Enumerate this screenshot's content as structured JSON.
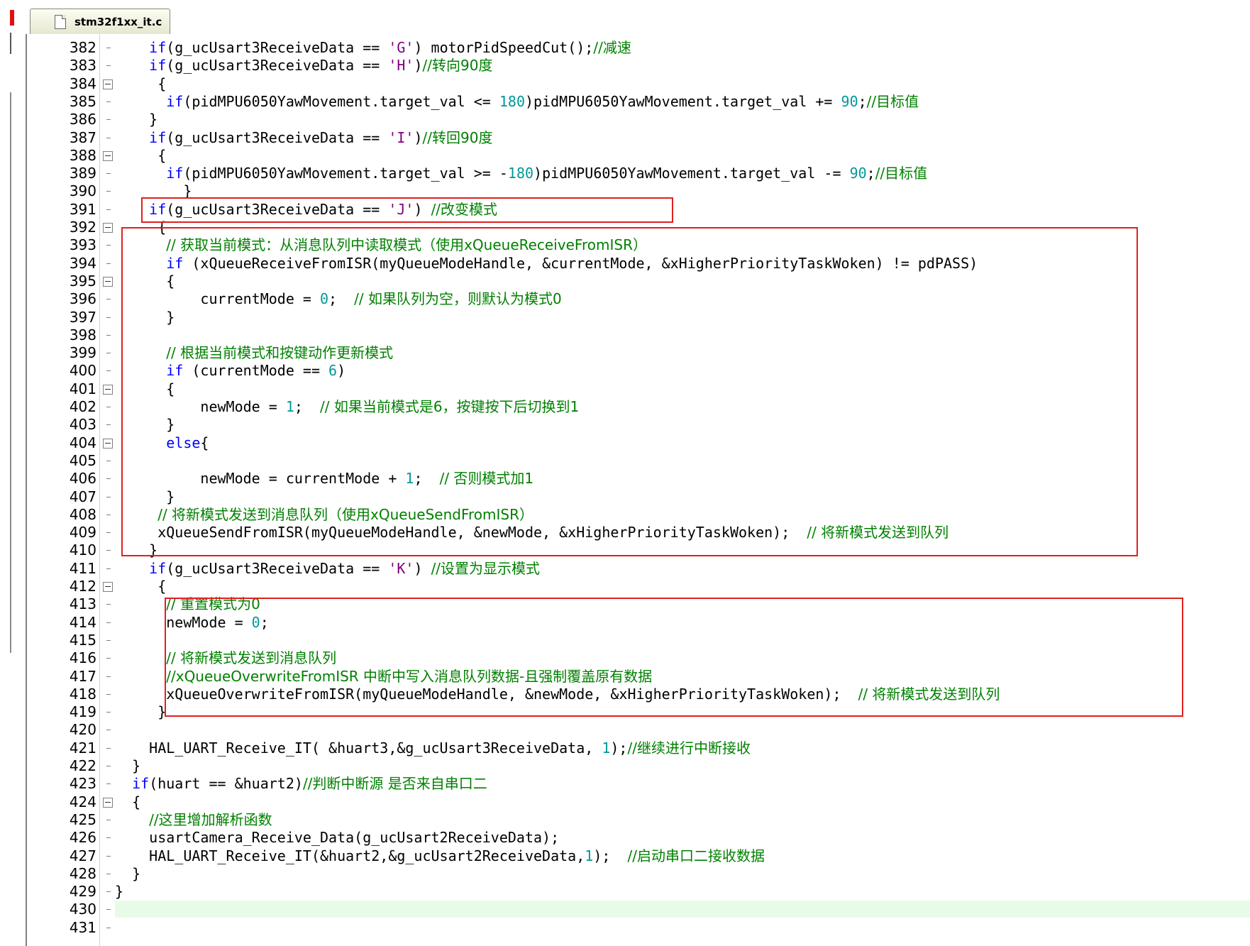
{
  "tab": {
    "filename": "stm32f1xx_it.c"
  },
  "lines": [
    {
      "n": "382",
      "code": [
        {
          "t": "    "
        },
        {
          "t": "if",
          "c": "kw"
        },
        {
          "t": "(g_ucUsart3ReceiveData == "
        },
        {
          "t": "'G'",
          "c": "str"
        },
        {
          "t": ") motorPidSpeedCut();"
        },
        {
          "t": "//减速",
          "c": "cmt"
        }
      ]
    },
    {
      "n": "383",
      "code": [
        {
          "t": "    "
        },
        {
          "t": "if",
          "c": "kw"
        },
        {
          "t": "(g_ucUsart3ReceiveData == "
        },
        {
          "t": "'H'",
          "c": "str"
        },
        {
          "t": ")"
        },
        {
          "t": "//转向90度",
          "c": "cmt"
        }
      ]
    },
    {
      "n": "384",
      "fold": true,
      "code": [
        {
          "t": "     {"
        }
      ]
    },
    {
      "n": "385",
      "code": [
        {
          "t": "      "
        },
        {
          "t": "if",
          "c": "kw"
        },
        {
          "t": "(pidMPU6050YawMovement.target_val <= "
        },
        {
          "t": "180",
          "c": "num"
        },
        {
          "t": ")pidMPU6050YawMovement.target_val += "
        },
        {
          "t": "90",
          "c": "num"
        },
        {
          "t": ";"
        },
        {
          "t": "//目标值",
          "c": "cmt"
        }
      ]
    },
    {
      "n": "386",
      "code": [
        {
          "t": "    }"
        }
      ]
    },
    {
      "n": "387",
      "code": [
        {
          "t": "    "
        },
        {
          "t": "if",
          "c": "kw"
        },
        {
          "t": "(g_ucUsart3ReceiveData == "
        },
        {
          "t": "'I'",
          "c": "str"
        },
        {
          "t": ")"
        },
        {
          "t": "//转回90度",
          "c": "cmt"
        }
      ]
    },
    {
      "n": "388",
      "fold": true,
      "code": [
        {
          "t": "     {"
        }
      ]
    },
    {
      "n": "389",
      "code": [
        {
          "t": "      "
        },
        {
          "t": "if",
          "c": "kw"
        },
        {
          "t": "(pidMPU6050YawMovement.target_val >= -"
        },
        {
          "t": "180",
          "c": "num"
        },
        {
          "t": ")pidMPU6050YawMovement.target_val -= "
        },
        {
          "t": "90",
          "c": "num"
        },
        {
          "t": ";"
        },
        {
          "t": "//目标值",
          "c": "cmt"
        }
      ]
    },
    {
      "n": "390",
      "code": [
        {
          "t": "        }"
        }
      ]
    },
    {
      "n": "391",
      "code": [
        {
          "t": "    "
        },
        {
          "t": "if",
          "c": "kw"
        },
        {
          "t": "(g_ucUsart3ReceiveData == "
        },
        {
          "t": "'J'",
          "c": "str"
        },
        {
          "t": ") "
        },
        {
          "t": "//改变模式",
          "c": "cmt"
        }
      ]
    },
    {
      "n": "392",
      "fold": true,
      "code": [
        {
          "t": "     {"
        }
      ]
    },
    {
      "n": "393",
      "code": [
        {
          "t": "      "
        },
        {
          "t": "// 获取当前模式：从消息队列中读取模式（使用xQueueReceiveFromISR）",
          "c": "cmt"
        }
      ]
    },
    {
      "n": "394",
      "code": [
        {
          "t": "      "
        },
        {
          "t": "if",
          "c": "kw"
        },
        {
          "t": " (xQueueReceiveFromISR(myQueueModeHandle, &currentMode, &xHigherPriorityTaskWoken) != pdPASS)"
        }
      ]
    },
    {
      "n": "395",
      "fold": true,
      "code": [
        {
          "t": "      {"
        }
      ]
    },
    {
      "n": "396",
      "code": [
        {
          "t": "          currentMode = "
        },
        {
          "t": "0",
          "c": "num"
        },
        {
          "t": ";  "
        },
        {
          "t": "// 如果队列为空，则默认为模式0",
          "c": "cmt"
        }
      ]
    },
    {
      "n": "397",
      "code": [
        {
          "t": "      }"
        }
      ]
    },
    {
      "n": "398",
      "code": [
        {
          "t": ""
        }
      ]
    },
    {
      "n": "399",
      "code": [
        {
          "t": "      "
        },
        {
          "t": "// 根据当前模式和按键动作更新模式",
          "c": "cmt"
        }
      ]
    },
    {
      "n": "400",
      "code": [
        {
          "t": "      "
        },
        {
          "t": "if",
          "c": "kw"
        },
        {
          "t": " (currentMode == "
        },
        {
          "t": "6",
          "c": "num"
        },
        {
          "t": ")"
        }
      ]
    },
    {
      "n": "401",
      "fold": true,
      "code": [
        {
          "t": "      {"
        }
      ]
    },
    {
      "n": "402",
      "code": [
        {
          "t": "          newMode = "
        },
        {
          "t": "1",
          "c": "num"
        },
        {
          "t": ";  "
        },
        {
          "t": "// 如果当前模式是6，按键按下后切换到1",
          "c": "cmt"
        }
      ]
    },
    {
      "n": "403",
      "code": [
        {
          "t": "      }"
        }
      ]
    },
    {
      "n": "404",
      "fold": true,
      "code": [
        {
          "t": "      "
        },
        {
          "t": "else",
          "c": "kw"
        },
        {
          "t": "{"
        }
      ]
    },
    {
      "n": "405",
      "code": [
        {
          "t": ""
        }
      ]
    },
    {
      "n": "406",
      "code": [
        {
          "t": "          newMode = currentMode + "
        },
        {
          "t": "1",
          "c": "num"
        },
        {
          "t": ";  "
        },
        {
          "t": "// 否则模式加1",
          "c": "cmt"
        }
      ]
    },
    {
      "n": "407",
      "code": [
        {
          "t": "      }"
        }
      ]
    },
    {
      "n": "408",
      "code": [
        {
          "t": "     "
        },
        {
          "t": "// 将新模式发送到消息队列（使用xQueueSendFromISR）",
          "c": "cmt"
        }
      ]
    },
    {
      "n": "409",
      "code": [
        {
          "t": "     xQueueSendFromISR(myQueueModeHandle, &newMode, &xHigherPriorityTaskWoken);  "
        },
        {
          "t": "// 将新模式发送到队列",
          "c": "cmt"
        }
      ]
    },
    {
      "n": "410",
      "code": [
        {
          "t": "    }"
        }
      ]
    },
    {
      "n": "411",
      "code": [
        {
          "t": "    "
        },
        {
          "t": "if",
          "c": "kw"
        },
        {
          "t": "(g_ucUsart3ReceiveData == "
        },
        {
          "t": "'K'",
          "c": "str"
        },
        {
          "t": ") "
        },
        {
          "t": "//设置为显示模式",
          "c": "cmt"
        }
      ]
    },
    {
      "n": "412",
      "fold": true,
      "code": [
        {
          "t": "     {"
        }
      ]
    },
    {
      "n": "413",
      "code": [
        {
          "t": "      "
        },
        {
          "t": "// 重置模式为0",
          "c": "cmt"
        }
      ]
    },
    {
      "n": "414",
      "code": [
        {
          "t": "      newMode = "
        },
        {
          "t": "0",
          "c": "num"
        },
        {
          "t": ";"
        }
      ]
    },
    {
      "n": "415",
      "code": [
        {
          "t": ""
        }
      ]
    },
    {
      "n": "416",
      "code": [
        {
          "t": "      "
        },
        {
          "t": "// 将新模式发送到消息队列",
          "c": "cmt"
        }
      ]
    },
    {
      "n": "417",
      "code": [
        {
          "t": "      "
        },
        {
          "t": "//xQueueOverwriteFromISR 中断中写入消息队列数据-且强制覆盖原有数据",
          "c": "cmt"
        }
      ]
    },
    {
      "n": "418",
      "code": [
        {
          "t": "      xQueueOverwriteFromISR(myQueueModeHandle, &newMode, &xHigherPriorityTaskWoken);  "
        },
        {
          "t": "// 将新模式发送到队列",
          "c": "cmt"
        }
      ]
    },
    {
      "n": "419",
      "code": [
        {
          "t": "     }"
        }
      ]
    },
    {
      "n": "420",
      "code": [
        {
          "t": ""
        }
      ]
    },
    {
      "n": "421",
      "code": [
        {
          "t": "    HAL_UART_Receive_IT( &huart3,&g_ucUsart3ReceiveData, "
        },
        {
          "t": "1",
          "c": "num"
        },
        {
          "t": ");"
        },
        {
          "t": "//继续进行中断接收",
          "c": "cmt"
        }
      ]
    },
    {
      "n": "422",
      "code": [
        {
          "t": "  }"
        }
      ]
    },
    {
      "n": "423",
      "code": [
        {
          "t": "  "
        },
        {
          "t": "if",
          "c": "kw"
        },
        {
          "t": "(huart == &huart2)"
        },
        {
          "t": "//判断中断源 是否来自串口二",
          "c": "cmt"
        }
      ]
    },
    {
      "n": "424",
      "fold": true,
      "code": [
        {
          "t": "  {"
        }
      ]
    },
    {
      "n": "425",
      "code": [
        {
          "t": "    "
        },
        {
          "t": "//这里增加解析函数",
          "c": "cmt"
        }
      ]
    },
    {
      "n": "426",
      "code": [
        {
          "t": "    usartCamera_Receive_Data(g_ucUsart2ReceiveData);"
        }
      ]
    },
    {
      "n": "427",
      "code": [
        {
          "t": "    HAL_UART_Receive_IT(&huart2,&g_ucUsart2ReceiveData,"
        },
        {
          "t": "1",
          "c": "num"
        },
        {
          "t": ");  "
        },
        {
          "t": "//启动串口二接收数据",
          "c": "cmt"
        }
      ]
    },
    {
      "n": "428",
      "code": [
        {
          "t": "  }"
        }
      ]
    },
    {
      "n": "429",
      "code": [
        {
          "t": "}"
        }
      ]
    },
    {
      "n": "430",
      "highlight": true,
      "code": [
        {
          "t": ""
        }
      ]
    },
    {
      "n": "431",
      "code": [
        {
          "t": ""
        }
      ]
    }
  ]
}
